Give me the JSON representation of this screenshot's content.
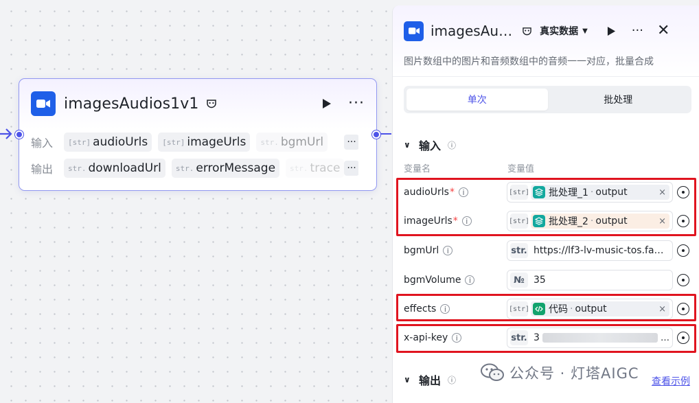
{
  "node": {
    "title": "imagesAudios1v1",
    "inputs_label": "输入",
    "outputs_label": "输出",
    "inputs": [
      {
        "type": "[str]",
        "name": "audioUrls"
      },
      {
        "type": "[str]",
        "name": "imageUrls"
      },
      {
        "type": "str.",
        "name": "bgmUrl"
      }
    ],
    "outputs": [
      {
        "type": "str.",
        "name": "downloadUrl"
      },
      {
        "type": "str.",
        "name": "errorMessage"
      },
      {
        "type": "str.",
        "name": "trace"
      }
    ],
    "more_label": "···"
  },
  "panel": {
    "title": "imagesAu…",
    "mode": "真实数据",
    "description": "图片数组中的图片和音频数组中的音频一一对应，批量合成",
    "tabs": [
      {
        "label": "单次",
        "active": true
      },
      {
        "label": "批处理",
        "active": false
      }
    ],
    "input_section": "输入",
    "output_section": "输出",
    "col_name": "变量名",
    "col_value": "变量值",
    "vars": [
      {
        "name": "audioUrls",
        "required": true,
        "type": "[str]",
        "ref_node": "批处理_1",
        "ref_field": "output"
      },
      {
        "name": "imageUrls",
        "required": true,
        "type": "[str]",
        "ref_node": "批处理_2",
        "ref_field": "output"
      },
      {
        "name": "bgmUrl",
        "required": false,
        "type": "str.",
        "value": "https://lf3-lv-music-tos.fa…"
      },
      {
        "name": "bgmVolume",
        "required": false,
        "type": "№",
        "value": "35"
      },
      {
        "name": "effects",
        "required": false,
        "type": "[str]",
        "ref_node": "代码",
        "ref_field": "output"
      },
      {
        "name": "x-api-key",
        "required": false,
        "type": "str.",
        "value": "3",
        "suffix": "…"
      }
    ],
    "req_mark": "*",
    "ref_sep": "·",
    "remove_mark": "×",
    "example_link": "查看示例"
  },
  "watermark": "公众号 · 灯塔AIGC",
  "colors": {
    "accent": "#4d53e8",
    "brand_blue": "#1f5fe8",
    "highlight_red": "#e0141f"
  }
}
